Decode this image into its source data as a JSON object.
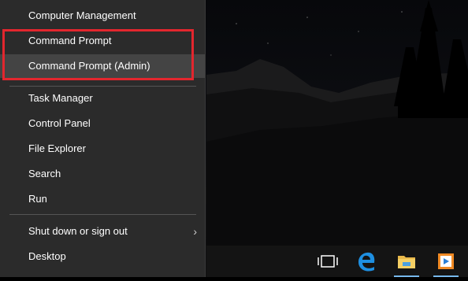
{
  "menu": {
    "items": [
      {
        "label": "Computer Management"
      },
      {
        "label": "Command Prompt"
      },
      {
        "label": "Command Prompt (Admin)"
      },
      {
        "label": "Task Manager"
      },
      {
        "label": "Control Panel"
      },
      {
        "label": "File Explorer"
      },
      {
        "label": "Search"
      },
      {
        "label": "Run"
      },
      {
        "label": "Shut down or sign out"
      },
      {
        "label": "Desktop"
      }
    ]
  },
  "annotation": {
    "highlight_color": "#e3262e",
    "arrow_color": "#000000"
  },
  "taskbar": {
    "icons": [
      "task-view-icon",
      "edge-icon",
      "file-explorer-icon",
      "media-player-icon"
    ]
  }
}
